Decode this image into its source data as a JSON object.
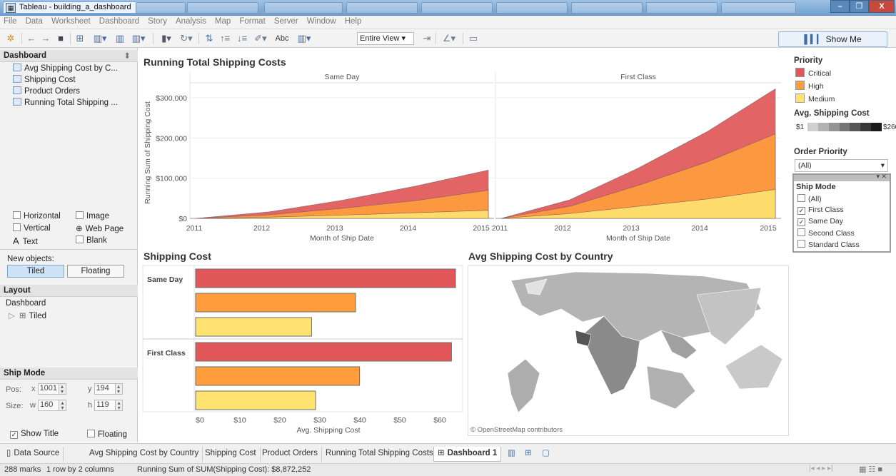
{
  "window": {
    "title": "Tableau - building_a_dashboard",
    "controls": {
      "minimize": "–",
      "restore": "❐",
      "close": "X"
    }
  },
  "menu": [
    "File",
    "Data",
    "Worksheet",
    "Dashboard",
    "Story",
    "Analysis",
    "Map",
    "Format",
    "Server",
    "Window",
    "Help"
  ],
  "toolbar": {
    "text_button": "Abc",
    "fit_value": "Entire View",
    "show_me": "Show Me"
  },
  "left_panel": {
    "dashboard_header": "Dashboard",
    "sheets": [
      "Avg Shipping Cost by C...",
      "Shipping Cost",
      "Product Orders",
      "Running Total Shipping ..."
    ],
    "objects": {
      "horizontal": "Horizontal",
      "image": "Image",
      "vertical": "Vertical",
      "web_page": "Web Page",
      "text": "Text",
      "blank": "Blank"
    },
    "new_objects_label": "New objects:",
    "tiled_button": "Tiled",
    "floating_button": "Floating",
    "layout_header": "Layout",
    "layout_root": "Dashboard",
    "layout_child": "Tiled",
    "selection_header": "Ship Mode",
    "pos_label": "Pos:",
    "size_label": "Size:",
    "x_label": "x",
    "x_value": "1001",
    "y_label": "y",
    "y_value": "194",
    "w_label": "w",
    "w_value": "160",
    "h_label": "h",
    "h_value": "119",
    "show_title": "Show Title",
    "floating_checkbox": "Floating"
  },
  "running_total": {
    "title": "Running Total Shipping Costs",
    "panel_headers": [
      "Same Day",
      "First Class"
    ],
    "y_axis_label": "Running Sum of Shipping Cost",
    "y_ticks": [
      "$300,000",
      "$200,000",
      "$100,000",
      "$0"
    ],
    "x_ticks": [
      "2011",
      "2012",
      "2013",
      "2014",
      "2015"
    ],
    "x_axis_label": "Month of Ship Date"
  },
  "shipping_cost": {
    "title": "Shipping Cost",
    "row_headers": [
      "Same Day",
      "First Class"
    ],
    "x_ticks": [
      "$0",
      "$10",
      "$20",
      "$30",
      "$40",
      "$50",
      "$60"
    ],
    "x_axis_label": "Avg. Shipping Cost"
  },
  "map": {
    "title": "Avg Shipping Cost by Country",
    "attribution": "© OpenStreetMap contributors"
  },
  "legend": {
    "priority_title": "Priority",
    "priority_items": [
      {
        "label": "Critical",
        "color": "#e15759"
      },
      {
        "label": "High",
        "color": "#ff9d3c"
      },
      {
        "label": "Medium",
        "color": "#ffe270"
      }
    ],
    "avg_cost_title": "Avg. Shipping Cost",
    "avg_cost_min": "$1",
    "avg_cost_max": "$260",
    "order_priority_title": "Order Priority",
    "order_priority_value": "(All)",
    "ship_mode_title": "Ship Mode",
    "ship_mode_options": [
      {
        "label": "(All)",
        "checked": false
      },
      {
        "label": "First Class",
        "checked": true
      },
      {
        "label": "Same Day",
        "checked": true
      },
      {
        "label": "Second Class",
        "checked": false
      },
      {
        "label": "Standard Class",
        "checked": false
      }
    ]
  },
  "tabs": [
    "Data Source",
    "Avg Shipping Cost by Country",
    "Shipping Cost",
    "Product Orders",
    "Running Total Shipping Costs",
    "Dashboard 1"
  ],
  "status": {
    "marks": "288 marks",
    "dims": "1 row by 2 columns",
    "summary": "Running Sum of SUM(Shipping Cost): $8,872,252"
  },
  "chart_data": [
    {
      "type": "area",
      "title": "Running Total Shipping Costs",
      "xlabel": "Month of Ship Date",
      "ylabel": "Running Sum of Shipping Cost",
      "ylim": [
        0,
        330000
      ],
      "stacked": true,
      "panels": [
        {
          "name": "Same Day",
          "x": [
            "2011",
            "2012",
            "2013",
            "2014",
            "2015"
          ],
          "series": [
            {
              "name": "Medium",
              "values": [
                0,
                3000,
                8000,
                14000,
                20000
              ]
            },
            {
              "name": "High",
              "values": [
                0,
                9000,
                25000,
                44000,
                70000
              ]
            },
            {
              "name": "Critical",
              "values": [
                0,
                16000,
                45000,
                80000,
                120000
              ]
            }
          ]
        },
        {
          "name": "First Class",
          "x": [
            "2011",
            "2012",
            "2013",
            "2014",
            "2015"
          ],
          "series": [
            {
              "name": "Medium",
              "values": [
                0,
                12000,
                30000,
                48000,
                72000
              ]
            },
            {
              "name": "High",
              "values": [
                0,
                30000,
                82000,
                140000,
                210000
              ]
            },
            {
              "name": "Critical",
              "values": [
                0,
                46000,
                125000,
                215000,
                322000
              ]
            }
          ]
        }
      ]
    },
    {
      "type": "bar",
      "title": "Shipping Cost",
      "xlabel": "Avg. Shipping Cost",
      "xlim": [
        0,
        65
      ],
      "categories": [
        "Same Day",
        "First Class"
      ],
      "series": [
        {
          "name": "Critical",
          "values": [
            65,
            64
          ]
        },
        {
          "name": "High",
          "values": [
            40,
            41
          ]
        },
        {
          "name": "Medium",
          "values": [
            29,
            30
          ]
        }
      ]
    }
  ]
}
